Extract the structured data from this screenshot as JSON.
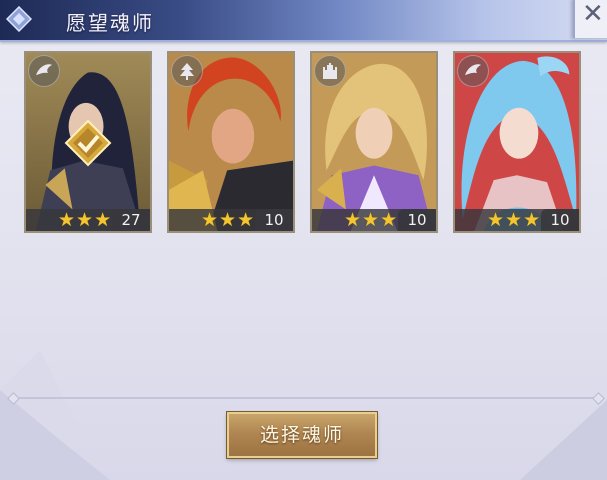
{
  "header": {
    "title": "愿望魂师",
    "close_icon": "close-icon"
  },
  "cards": [
    {
      "faction_icon": "wing-icon",
      "stars": "★★★",
      "level": "27",
      "selected": true,
      "art_colors": [
        "#8a7446",
        "#2b2a3a"
      ]
    },
    {
      "faction_icon": "tree-icon",
      "stars": "★★★",
      "level": "10",
      "selected": false,
      "art_colors": [
        "#c65a2c",
        "#3a2718"
      ]
    },
    {
      "faction_icon": "castle-icon",
      "stars": "★★★",
      "level": "10",
      "selected": false,
      "art_colors": [
        "#c9a24e",
        "#6b3fa1"
      ]
    },
    {
      "faction_icon": "wing-icon",
      "stars": "★★★",
      "level": "10",
      "selected": false,
      "art_colors": [
        "#d24a4a",
        "#7ec6e9"
      ]
    }
  ],
  "actions": {
    "select_label": "选择魂师"
  }
}
